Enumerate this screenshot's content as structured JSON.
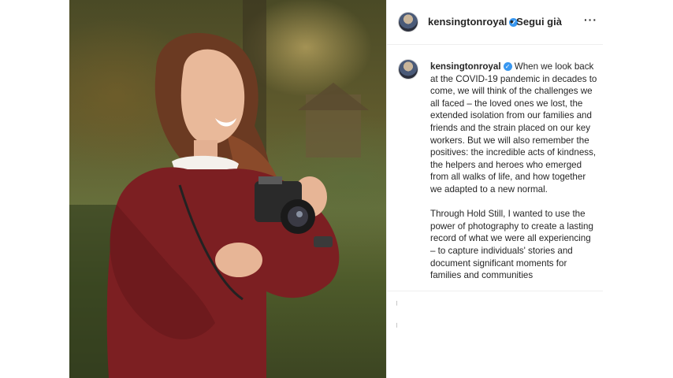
{
  "post": {
    "username": "kensingtonroyal",
    "follow_status": "• Segui già",
    "more_label": "···",
    "verified_icon": "verified-badge-icon",
    "caption_paragraph_1": "When we look back at the COVID-19 pandemic in decades to come, we will think of the challenges we all faced – the loved ones we lost, the extended isolation from our families and friends and the strain placed on our key workers. But we will also remember the positives: the incredible acts of kindness, the helpers and heroes who emerged from all walks of life, and how together we adapted to a new normal.",
    "caption_paragraph_2": "Through Hold Still, I wanted to use the power of photography to create a lasting record of what we were all experiencing – to capture individuals' stories and document significant moments for families and communities"
  },
  "colors": {
    "verified": "#3897f0",
    "border": "#efefef",
    "text": "#262626"
  }
}
